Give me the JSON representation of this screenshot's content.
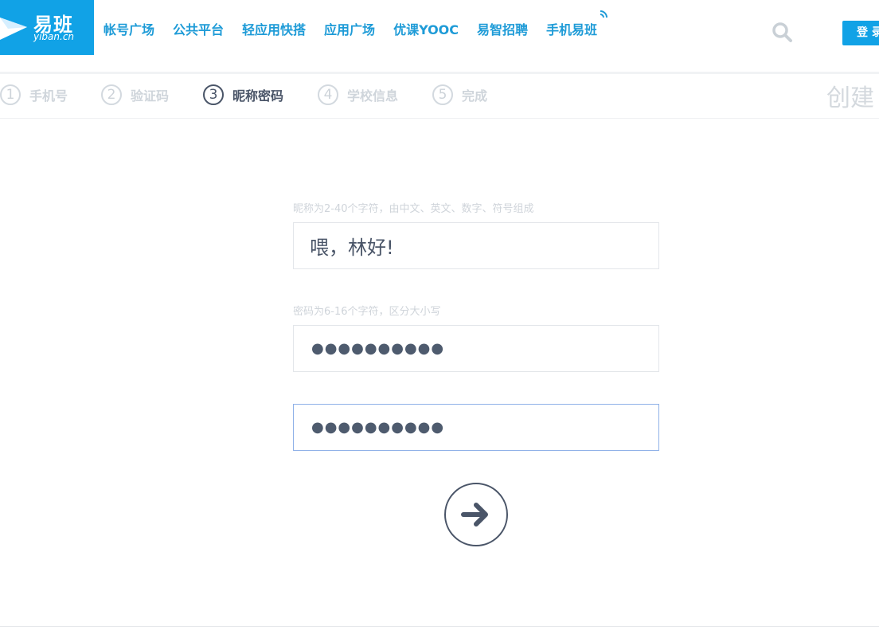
{
  "header": {
    "logo": {
      "brand_cn": "易班",
      "brand_en": "yiban.cn"
    },
    "nav": [
      "帐号广场",
      "公共平台",
      "轻应用快搭",
      "应用广场",
      "优课YOOC",
      "易智招聘",
      "手机易班"
    ],
    "login_label": "登 录"
  },
  "steps": {
    "items": [
      {
        "num": "1",
        "label": "手机号"
      },
      {
        "num": "2",
        "label": "验证码"
      },
      {
        "num": "3",
        "label": "昵称密码"
      },
      {
        "num": "4",
        "label": "学校信息"
      },
      {
        "num": "5",
        "label": "完成"
      }
    ],
    "active_step": "3",
    "page_title": "创建"
  },
  "form": {
    "nickname_hint": "昵称为2-40个字符，由中文、英文、数字、符号组成",
    "nickname_value": "喂，林好!",
    "password_hint": "密码为6-16个字符，区分大小写",
    "password_mask": "●●●●●●●●●●",
    "confirm_mask": "●●●●●●●●●●"
  },
  "colors": {
    "brand": "#11a2e6",
    "nav_text": "#1e9bd7",
    "active_step": "#4a5568",
    "inactive_step": "#cfd5db",
    "focus_border": "#8fb1e8"
  }
}
